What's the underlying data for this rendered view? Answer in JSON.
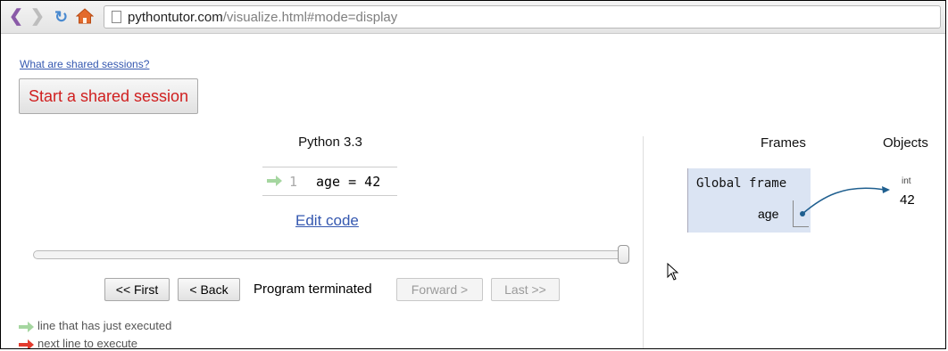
{
  "browser": {
    "url_host": "pythontutor.com",
    "url_path": "/visualize.html#mode=display"
  },
  "page": {
    "shared_sessions_link": "What are shared sessions?",
    "start_shared_button": "Start a shared session"
  },
  "editor": {
    "language": "Python 3.3",
    "line_number": "1",
    "code": "age = 42",
    "edit_link": "Edit code"
  },
  "navigation": {
    "first": "<< First",
    "back": "< Back",
    "status": "Program terminated",
    "forward": "Forward >",
    "last": "Last >>"
  },
  "legend": {
    "executed": "line that has just executed",
    "next": "next line to execute"
  },
  "visualization": {
    "frames_header": "Frames",
    "objects_header": "Objects",
    "frame_title": "Global frame",
    "variable": "age",
    "object_type": "int",
    "object_value": "42"
  },
  "colors": {
    "executed_arrow": "#a5d6a0",
    "next_arrow": "#e33b2e",
    "pointer": "#1f5f8f",
    "frame_bg": "#dbe4f3",
    "shared_button_text": "#d01f1f",
    "link": "#3558b0"
  }
}
